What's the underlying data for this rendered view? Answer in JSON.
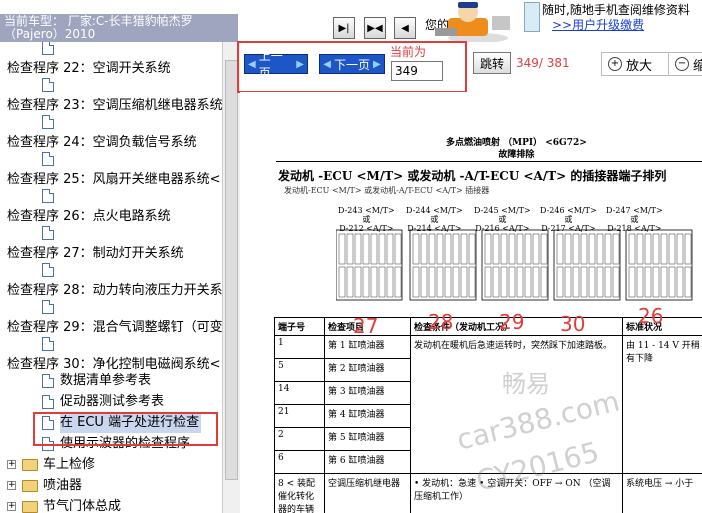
{
  "header": {
    "car_model": "当前车型：   厂家:C-长丰猎豹帕杰罗（Pajero）2010",
    "truncated_text": "您的",
    "promo_line1": "随时,随地手机查阅维修资料",
    "promo_link": ">>用户升级缴费"
  },
  "tree": {
    "items": [
      {
        "type": "doc",
        "label": ""
      },
      {
        "type": "section",
        "label": "检查程序 22：空调开关系统"
      },
      {
        "type": "doc",
        "label": ""
      },
      {
        "type": "section",
        "label": "检查程序 23：空调压缩机继电器系统"
      },
      {
        "type": "doc",
        "label": ""
      },
      {
        "type": "section",
        "label": "检查程序 24：空调负载信号系统"
      },
      {
        "type": "doc",
        "label": ""
      },
      {
        "type": "section",
        "label": "检查程序 25：风扇开关继电器系统<"
      },
      {
        "type": "doc",
        "label": ""
      },
      {
        "type": "section",
        "label": "检查程序 26：点火电路系统"
      },
      {
        "type": "doc",
        "label": ""
      },
      {
        "type": "section",
        "label": "检查程序 27：制动灯开关系统"
      },
      {
        "type": "doc",
        "label": ""
      },
      {
        "type": "section",
        "label": "检查程序 28：动力转向液压力开关系"
      },
      {
        "type": "doc",
        "label": ""
      },
      {
        "type": "section",
        "label": "检查程序 29：混合气调整螺钉（可变"
      },
      {
        "type": "doc",
        "label": ""
      },
      {
        "type": "section",
        "label": "检查程序 30：净化控制电磁阀系统<"
      },
      {
        "type": "doc",
        "label": "数据清单参考表"
      },
      {
        "type": "doc",
        "label": "促动器测试参考表"
      },
      {
        "type": "doc",
        "label": "在 ECU 端子处进行检查",
        "selected": true
      },
      {
        "type": "doc",
        "label": "使用示波器的检查程序"
      },
      {
        "type": "folder",
        "label": "车上检修"
      },
      {
        "type": "folder",
        "label": "喷油器"
      },
      {
        "type": "folder",
        "label": "节气门体总成"
      }
    ]
  },
  "toolbar": {
    "prev_label": "上一页",
    "next_label": "下一页",
    "current_label": "当前为",
    "page_value": "349",
    "jump_label": "跳转",
    "page_count": "349/ 381",
    "zoom_in_label": "放大",
    "zoom_out_label": "缩"
  },
  "document": {
    "header_line1": "多点燃油喷射 （MPI） <6G72>",
    "header_line2": "故障排除",
    "title": "发动机 -ECU <M/T> 或发动机 -A/T-ECU <A/T> 的插接器端子排列",
    "subtitle": "发动机-ECU <M/T> 或发动机-A/T-ECU <A/T> 插接器",
    "connectors": [
      {
        "top": "D-243 <M/T>",
        "mid": "或",
        "bottom": "D-212 <A/T>"
      },
      {
        "top": "D-244 <M/T>",
        "mid": "或",
        "bottom": "D-214 <A/T>"
      },
      {
        "top": "D-245 <M/T>",
        "mid": "或",
        "bottom": "D-216 <A/T>"
      },
      {
        "top": "D-246 <M/T>",
        "mid": "或",
        "bottom": "D-217 <A/T>"
      },
      {
        "top": "D-247 <M/T>",
        "mid": "或",
        "bottom": "D-218 <A/T>"
      }
    ],
    "table_headers": [
      "端子号",
      "检查项目",
      "检查条件（发动机工况）",
      "标准状况"
    ],
    "rows": [
      {
        "terminal": "1",
        "item": "第 1 缸喷油器"
      },
      {
        "terminal": "5",
        "item": "第 2 缸喷油器"
      },
      {
        "terminal": "14",
        "item": "第 3 缸喷油器"
      },
      {
        "terminal": "21",
        "item": "第 4 缸喷油器"
      },
      {
        "terminal": "2",
        "item": "第 5 缸喷油器"
      },
      {
        "terminal": "6",
        "item": "第 6 缸喷油器"
      },
      {
        "terminal": "8 < 装配催化转化器的车辆",
        "item": "空调压缩机继电器"
      }
    ],
    "condition_injector": "发动机在暖机后急速运转时，突然踩下加速踏板。",
    "standard_injector": "由 11 - 14 V 开稍有下降",
    "condition_compressor": "• 发动机：急速 • 空调开关：OFF → ON （空调压缩机工作）",
    "standard_compressor": "系统电压 → 小于",
    "red_annotations": [
      "27",
      "28",
      "29",
      "30",
      "26"
    ],
    "watermarks": [
      "畅易",
      "car388.com",
      "CY20165"
    ]
  },
  "colors": {
    "header_bar": "#9fa4bf",
    "nav_button": "#1d56c7",
    "highlight_red": "#e13c3c"
  }
}
